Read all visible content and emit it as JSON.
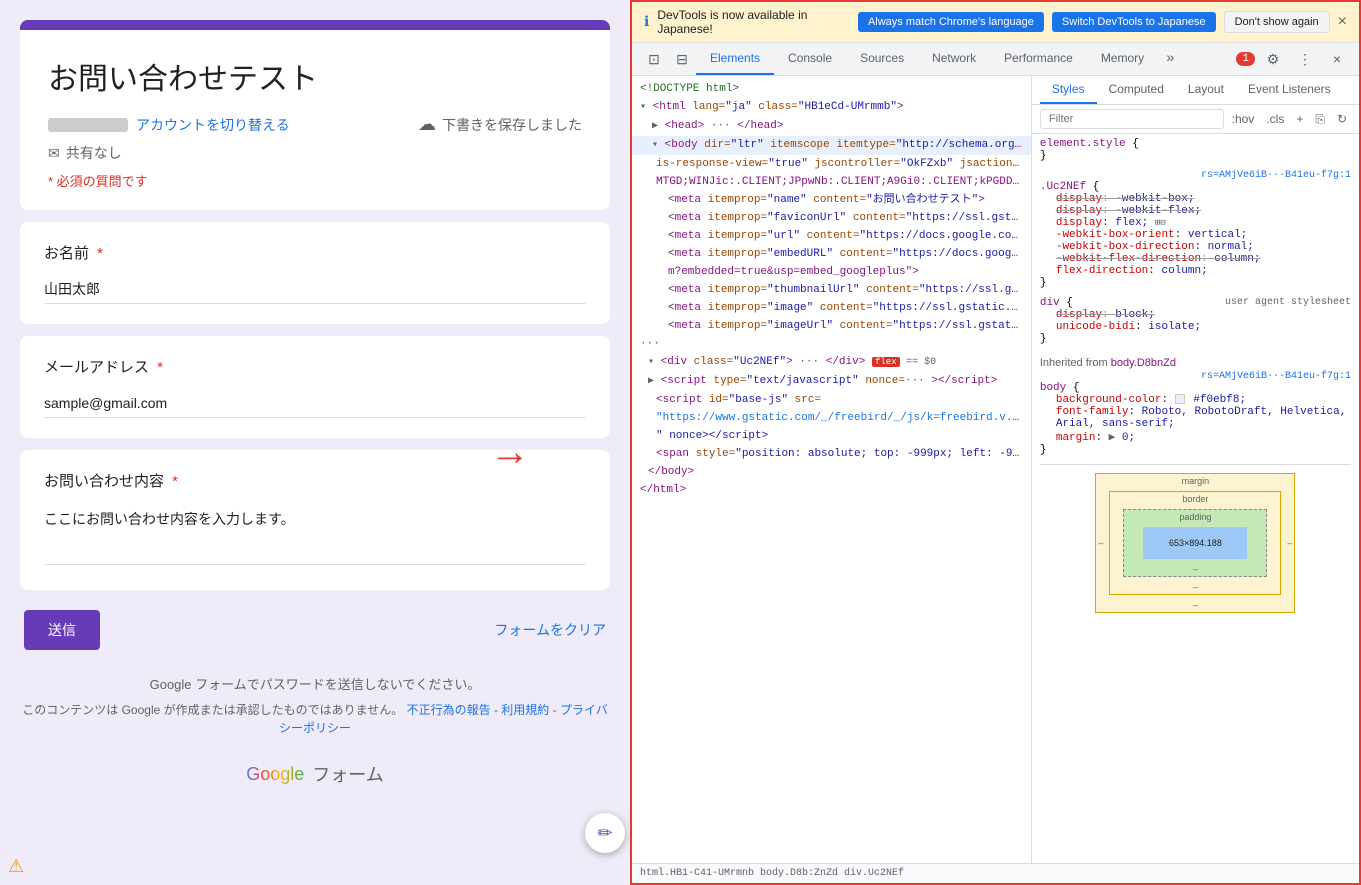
{
  "form": {
    "title": "お問い合わせテスト",
    "account_switch": "アカウントを切り替える",
    "draft_saved": "下書きを保存しました",
    "share_label": "共有なし",
    "required_note": "* 必須の質問です",
    "name_label": "お名前",
    "name_value": "山田太郎",
    "email_label": "メールアドレス",
    "email_value": "sample@gmail.com",
    "inquiry_label": "お問い合わせ内容",
    "inquiry_placeholder": "ここにお問い合わせ内容を入力します。",
    "submit_btn": "送信",
    "clear_btn": "フォームをクリア",
    "password_notice": "Google フォームでパスワードを送信しないでください。",
    "content_notice_prefix": "このコンテンツは Google が作成または承認したものではありません。",
    "report_link": "不正行為の報告",
    "terms_link": "利用規約",
    "privacy_link": "プライバシーポリシー",
    "google_forms_label": "Google フォーム"
  },
  "devtools": {
    "notification": {
      "text": "DevTools is now available in Japanese!",
      "btn1": "Always match Chrome's language",
      "btn2": "Switch DevTools to Japanese",
      "btn3": "Don't show again"
    },
    "tabs": {
      "elements": "Elements",
      "console": "Console",
      "sources": "Sources",
      "network": "Network",
      "performance": "Performance",
      "memory": "Memory"
    },
    "styles_tabs": {
      "styles": "Styles",
      "computed": "Computed",
      "layout": "Layout",
      "event_listeners": "Event Listeners"
    },
    "filter_placeholder": "Filter",
    "filter_hover": ":hov",
    "filter_cls": ".cls",
    "styles_content": {
      "element_style": "element.style {",
      "rule1_selector": ".Uc2NEf {",
      "rule1_source": "rs=AMjVe6iB···B41eu-f7g:1",
      "display_webkit_box": "display: -webkit-box;",
      "display_webkit_flex": "display: -webkit-flex;",
      "display_flex": "display: flex;",
      "webkit_box_orient": "-webkit-box-orient: vertical;",
      "webkit_box_direction": "-webkit-box-direction: normal;",
      "webkit_flex_direction": "-webkit-flex-direction: column;",
      "flex_direction": "flex-direction: column;",
      "rule2_selector": "div {",
      "rule2_source": "user agent stylesheet",
      "display_block": "display: block;",
      "unicode_bidi": "unicode-bidi: isolate;",
      "inherited_from_body": "Inherited from body.D8bnZd",
      "body_selector": "body {",
      "body_source": "rs=AMjVe6iB···B41eu-f7g:1",
      "background_color": "background-color:",
      "background_color_value": "#f0ebf8;",
      "font_family": "font-family: Roboto, RobotoDraft, Helvetica,",
      "font_family2": "Arial, sans-serif;",
      "margin": "margin:",
      "margin_value": "▶ 0;"
    },
    "box_model": {
      "margin_label": "margin",
      "border_label": "border",
      "padding_label": "padding",
      "content_size": "653×894.188"
    }
  }
}
